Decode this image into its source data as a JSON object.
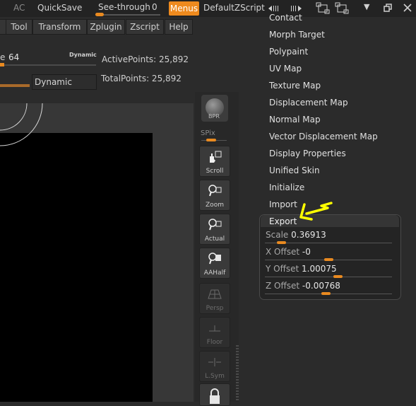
{
  "topbar": {
    "ac": "AC",
    "quicksave": "QuickSave",
    "see_through_label": "See-through",
    "see_through_value": "0",
    "menus": "Menus",
    "script_name": "DefaultZScript"
  },
  "menubar": {
    "items": [
      "Tool",
      "Transform",
      "Zplugin",
      "Zscript",
      "Help"
    ]
  },
  "brush": {
    "size_suffix": "e",
    "size_value": "64",
    "dynamic_small": "Dynamic",
    "dynamic_button": "Dynamic",
    "active_points": "ActivePoints: 25,892",
    "total_points": "TotalPoints: 25,892"
  },
  "shelf": {
    "bpr": "BPR",
    "spix": "SPix",
    "buttons": [
      "Scroll",
      "Zoom",
      "Actual",
      "AAHalf",
      "Persp",
      "Floor",
      "L.Sym"
    ]
  },
  "tool_menu": {
    "items": [
      "Contact",
      "Morph Target",
      "Polypaint",
      "UV Map",
      "Texture Map",
      "Displacement Map",
      "Normal Map",
      "Vector Displacement Map",
      "Display Properties",
      "Unified Skin",
      "Initialize",
      "Import"
    ],
    "export": {
      "title": "Export",
      "params": [
        {
          "label": "Scale",
          "value": "0.36913",
          "level": 0.1
        },
        {
          "label": "X Offset",
          "value": "-0",
          "level": 0.5
        },
        {
          "label": "Y Offset",
          "value": "1.00075",
          "level": 0.58
        },
        {
          "label": "Z Offset",
          "value": "-0.00768",
          "level": 0.48
        }
      ]
    }
  },
  "colors": {
    "accent": "#ee8a1e",
    "arrow": "#ffff00"
  }
}
